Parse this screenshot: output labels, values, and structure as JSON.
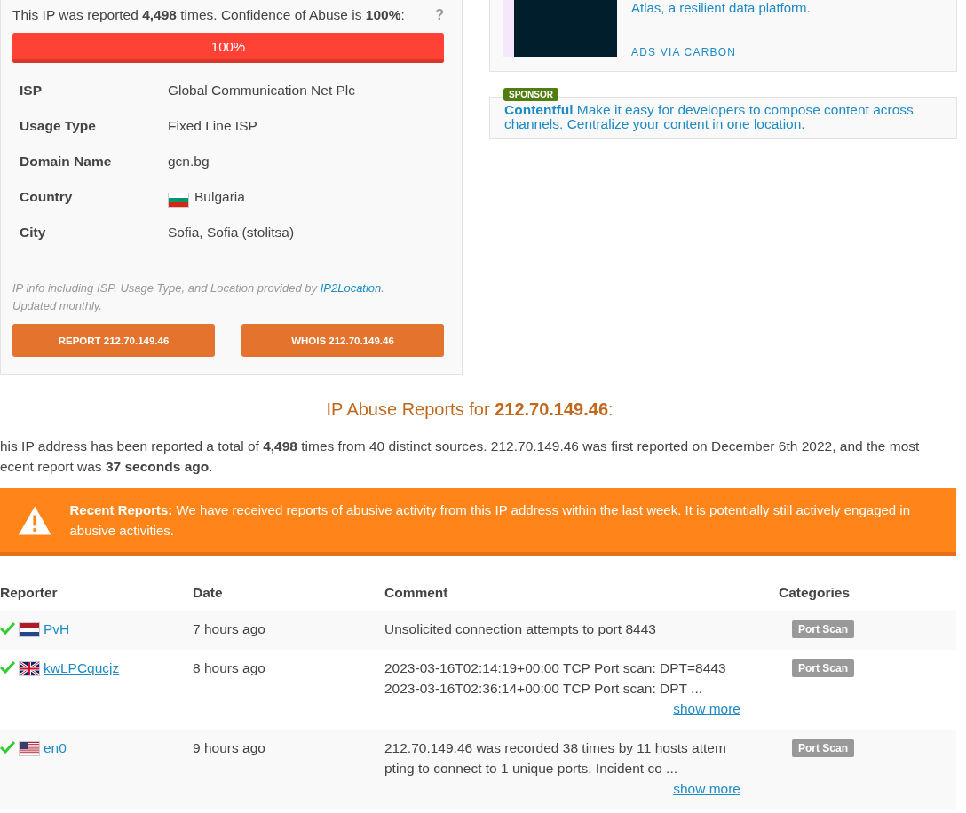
{
  "summary": {
    "text": "This IP was reported **4,498** times. Confidence of Abuse is **100%**:",
    "help": "?"
  },
  "confidence": {
    "level": 1,
    "label": "100%"
  },
  "details": [
    {
      "label": "ISP",
      "value": "Global Communication Net Plc"
    },
    {
      "label": "Usage Type",
      "value": "Fixed Line ISP"
    },
    {
      "label": "Domain Name",
      "value": "gcn.bg"
    },
    {
      "label": "Country",
      "value": "Bulgaria",
      "kind": "bg"
    },
    {
      "label": "City",
      "value": "Sofia, Sofia (stolitsa)"
    }
  ],
  "attribution": {
    "text": "IP info including ISP, Usage Type, and Location provided by",
    "link": "IP2Location",
    "after": ". Updated monthly."
  },
  "buttons": [
    "REPORT 212.70.149.46",
    "WHOIS 212.70.149.46"
  ],
  "ad": {
    "text": "Atlas, a resilient data platform.",
    "via": "ADS VIA CARBON"
  },
  "sponsor": {
    "badge": "SPONSOR",
    "name": "Contentful",
    "text": "Make it easy for developers to compose content across channels. Centralize your content in one location."
  },
  "reports_heading": {
    "text": "IP Abuse Reports for",
    "ip": "212.70.149.46",
    "after": ":"
  },
  "reports_summary": "his IP address has been reported a total of **4,498** times from 40 distinct sources. 212.70.149.46 was first reported on December 6th 2022, and the most\necent report was **37 seconds ago**.",
  "alert": {
    "title": "Recent Reports:",
    "text": "We have received reports of abusive activity from this IP address within the last week. It is potentially still actively engaged in abusive activities."
  },
  "table": {
    "columns": [
      "Reporter",
      "Date",
      "Comment",
      "Categories"
    ],
    "rows": [
      {
        "verified": true,
        "kind": "nl",
        "reporter": "PvH",
        "date": "7 hours ago",
        "comment": [
          "Unsolicited connection attempts to port 8443"
        ],
        "categories": [
          "Port Scan"
        ]
      },
      {
        "verified": true,
        "kind": "gb",
        "reporter": "kwLPCqucjz",
        "date": "8 hours ago",
        "comment": [
          "2023-03-16T02:14:19+00:00 TCP Port scan: DPT=8443",
          "2023-03-16T02:36:14+00:00 TCP Port scan: DPT ..."
        ],
        "more": "show more",
        "categories": [
          "Port Scan"
        ]
      },
      {
        "verified": true,
        "kind": "us",
        "reporter": "en0",
        "date": "9 hours ago",
        "comment": [
          "212.70.149.46 was recorded 38 times by 11 hosts attem",
          "pting to connect to 1 unique ports. Incident co ..."
        ],
        "more": "show more",
        "categories": [
          "Port Scan"
        ]
      }
    ]
  }
}
